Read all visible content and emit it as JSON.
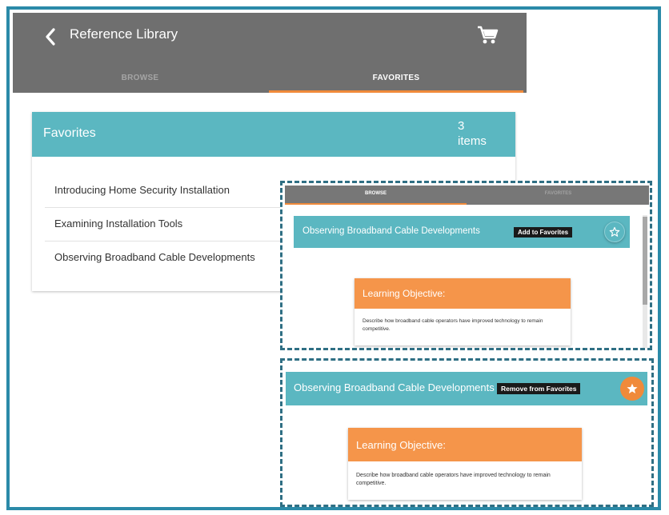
{
  "app": {
    "title": "Reference Library",
    "back_icon": "chevron-left-icon",
    "cart_icon": "shopping-cart-icon",
    "tabs": [
      {
        "label": "BROWSE",
        "active": false
      },
      {
        "label": "FAVORITES",
        "active": true
      }
    ]
  },
  "favorites": {
    "title": "Favorites",
    "count_number": "3",
    "count_unit": "items",
    "items": [
      {
        "label": "Introducing Home Security Installation"
      },
      {
        "label": "Examining Installation Tools"
      },
      {
        "label": "Observing Broadband Cable Developments"
      }
    ]
  },
  "callout_add": {
    "tabs": [
      {
        "label": "BROWSE",
        "active": true
      },
      {
        "label": "FAVORITES",
        "active": false
      }
    ],
    "title": "Observing Broadband Cable Developments",
    "tag": "Add to Favorites",
    "star_icon": "star-outline-icon",
    "objective_title": "Learning Objective:",
    "objective_text": "Describe how broadband cable operators have improved technology to remain competitive."
  },
  "callout_remove": {
    "title": "Observing Broadband Cable Developments",
    "tag": "Remove from Favorites",
    "star_icon": "star-filled-icon",
    "objective_title": "Learning Objective:",
    "objective_text": "Describe how broadband cable operators have improved technology to remain competitive."
  },
  "colors": {
    "appbar": "#6f6f6f",
    "accent_orange": "#f08a3a",
    "teal": "#5bb7c1",
    "callout_border": "#2f6f84",
    "frame_border": "#2b8aa8"
  }
}
